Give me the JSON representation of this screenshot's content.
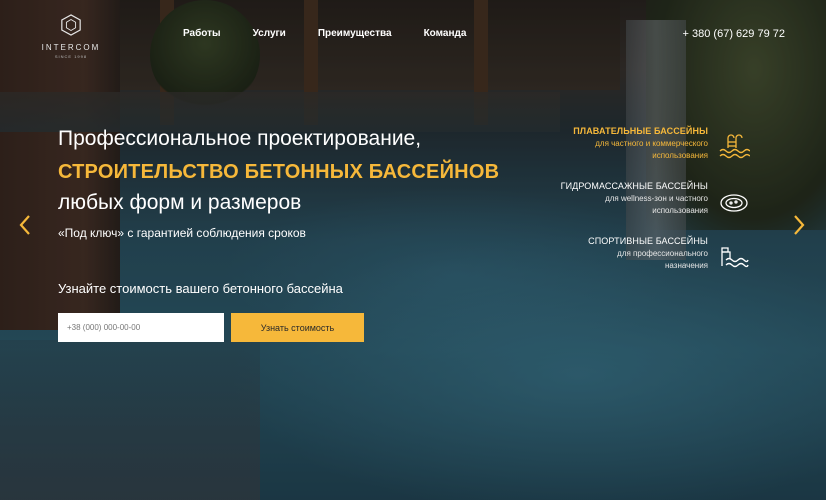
{
  "logo": {
    "name": "INTERCOM",
    "since": "SINCE 1998"
  },
  "nav": {
    "items": [
      {
        "label": "Работы"
      },
      {
        "label": "Услуги"
      },
      {
        "label": "Преимущества"
      },
      {
        "label": "Команда"
      }
    ]
  },
  "phone": "+ 380 (67) 629 79 72",
  "hero": {
    "line1": "Профессиональное проектирование,",
    "line2": "СТРОИТЕЛЬСТВО БЕТОННЫХ БАССЕЙНОВ",
    "line3": "любых форм и размеров",
    "subtitle": "«Под ключ» с гарантией соблюдения сроков",
    "cta_text": "Узнайте стоимость вашего бетонного бассейна"
  },
  "form": {
    "phone_placeholder": "+38 (000) 000-00-00",
    "phone_value": "",
    "button_label": "Узнать стоимость"
  },
  "pool_types": [
    {
      "title": "ПЛАВАТЕЛЬНЫЕ БАССЕЙНЫ",
      "desc1": "для частного и коммерческого",
      "desc2": "использования",
      "icon": "swimming-pool-icon",
      "active": true
    },
    {
      "title": "ГИДРОМАССАЖНЫЕ БАССЕЙНЫ",
      "desc1": "для wellness-зон и частного",
      "desc2": "использования",
      "icon": "jacuzzi-icon",
      "active": false
    },
    {
      "title": "СПОРТИВНЫЕ БАССЕЙНЫ",
      "desc1": "для профессионального",
      "desc2": "назначения",
      "icon": "sport-pool-icon",
      "active": false
    }
  ],
  "colors": {
    "accent": "#f6b83a",
    "text": "#ffffff"
  },
  "icons": {
    "prev": "chevron-left-icon",
    "next": "chevron-right-icon"
  }
}
